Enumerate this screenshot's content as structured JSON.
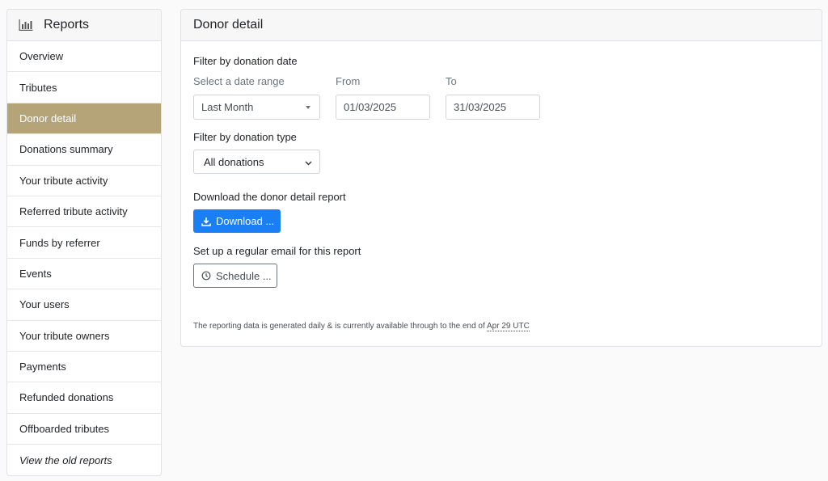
{
  "sidebar": {
    "title": "Reports",
    "title_icon": "bar-chart-icon",
    "items": [
      {
        "label": "Overview",
        "active": false
      },
      {
        "label": "Tributes",
        "active": false
      },
      {
        "label": "Donor detail",
        "active": true
      },
      {
        "label": "Donations summary",
        "active": false
      },
      {
        "label": "Your tribute activity",
        "active": false
      },
      {
        "label": "Referred tribute activity",
        "active": false
      },
      {
        "label": "Funds by referrer",
        "active": false
      },
      {
        "label": "Events",
        "active": false
      },
      {
        "label": "Your users",
        "active": false
      },
      {
        "label": "Your tribute owners",
        "active": false
      },
      {
        "label": "Payments",
        "active": false
      },
      {
        "label": "Refunded donations",
        "active": false
      },
      {
        "label": "Offboarded tributes",
        "active": false
      },
      {
        "label": "View the old reports",
        "active": false
      }
    ]
  },
  "main": {
    "title": "Donor detail",
    "date_filter": {
      "heading": "Filter by donation date",
      "range_label": "Select a date range",
      "range_value": "Last Month",
      "from_label": "From",
      "from_value": "01/03/2025",
      "to_label": "To",
      "to_value": "31/03/2025"
    },
    "type_filter": {
      "heading": "Filter by donation type",
      "value": "All donations"
    },
    "download": {
      "heading": "Download the donor detail report",
      "button_label": "Download ..."
    },
    "schedule": {
      "heading": "Set up a regular email for this report",
      "button_label": "Schedule ..."
    },
    "footnote": {
      "text": "The reporting data is generated daily & is currently available through to the end of",
      "date": "Apr 29 UTC"
    }
  },
  "colors": {
    "active_item": "#b5a478",
    "primary_button": "#1a7ef4"
  }
}
